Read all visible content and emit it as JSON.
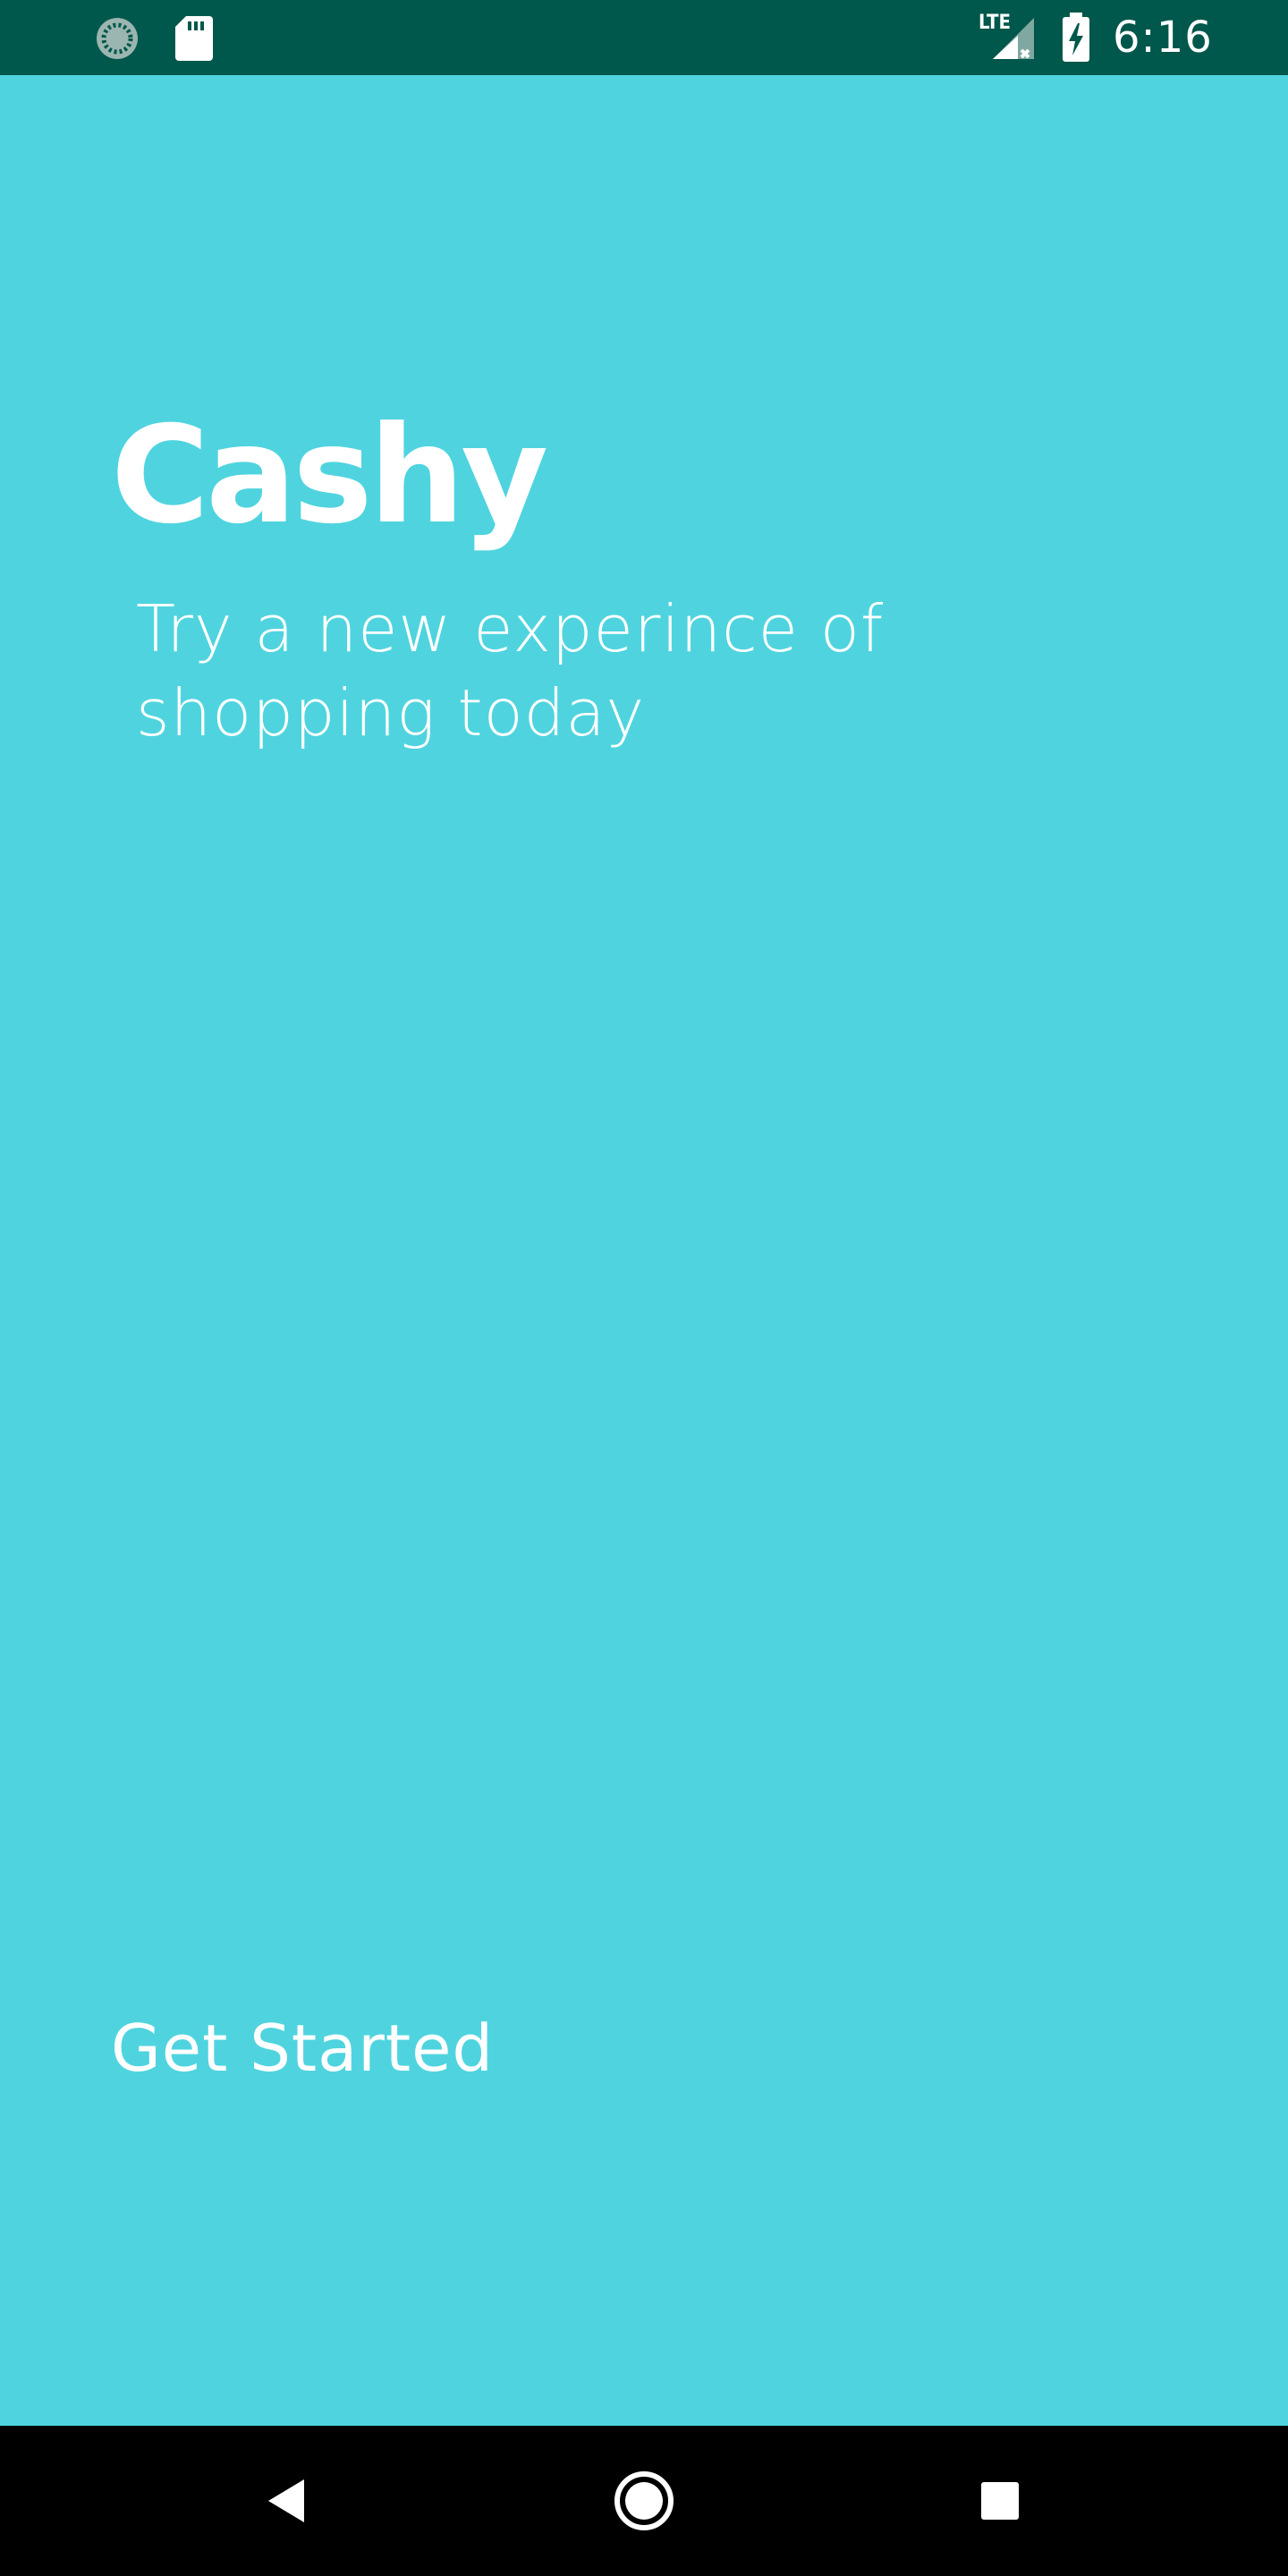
{
  "status_bar": {
    "time": "6:16",
    "left_icons": [
      "sync-icon",
      "sd-card-icon"
    ],
    "right_icons": [
      "lte-signal-icon",
      "battery-charging-icon"
    ],
    "network_label": "LTE",
    "background": "#00574b"
  },
  "app": {
    "logo": "Cashy",
    "tagline": "Try a new experince of shopping today",
    "cta_label": "Get Started",
    "background": "#4fd4df",
    "text_color": "#ffffff"
  },
  "nav_bar": {
    "buttons": [
      "back-icon",
      "home-icon",
      "recents-icon"
    ],
    "background": "#000000"
  }
}
